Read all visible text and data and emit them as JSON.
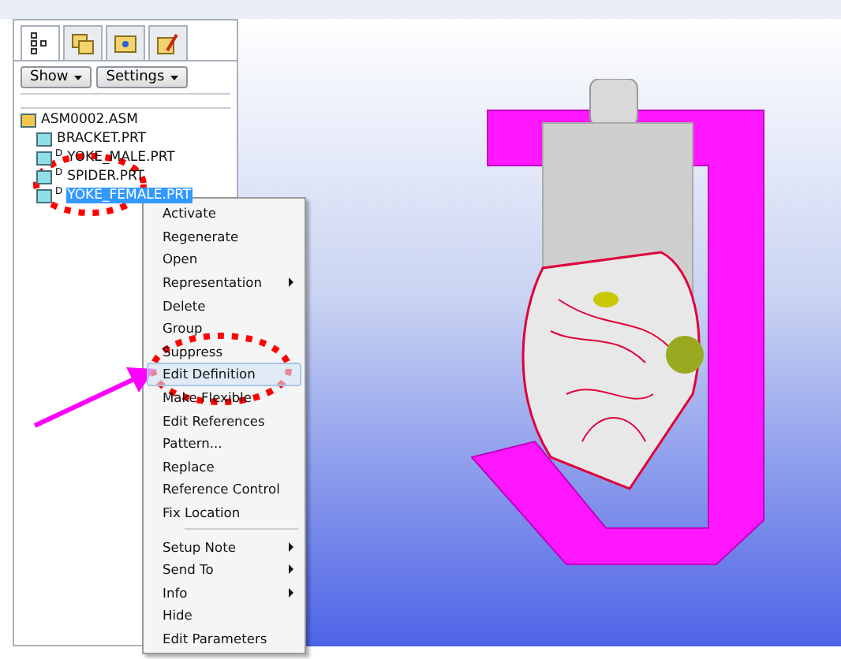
{
  "panel": {
    "tabs": [
      {
        "selected": true
      },
      {
        "selected": false
      },
      {
        "selected": false
      },
      {
        "selected": false
      }
    ],
    "buttons": [
      {
        "label": "Show"
      },
      {
        "label": "Settings"
      }
    ],
    "tree": {
      "label": "ASM0002.ASM",
      "children": [
        {
          "label": "BRACKET.PRT",
          "selected": false
        },
        {
          "label": "YOKE_MALE.PRT",
          "flag": "D",
          "selected": false
        },
        {
          "label": "SPIDER.PRT",
          "flag": "D",
          "selected": false
        },
        {
          "label": "YOKE_FEMALE.PRT",
          "flag": "D",
          "selected": true
        }
      ]
    }
  },
  "context_menu": {
    "groups": [
      [
        {
          "label": "Activate",
          "submenu": false,
          "selected": false
        },
        {
          "label": "Regenerate",
          "submenu": false,
          "selected": false
        },
        {
          "label": "Open",
          "submenu": false,
          "selected": false
        },
        {
          "label": "Representation",
          "submenu": true,
          "selected": false
        },
        {
          "label": "Delete",
          "submenu": false,
          "selected": false
        },
        {
          "label": "Group",
          "submenu": false,
          "selected": false
        },
        {
          "label": "Suppress",
          "submenu": false,
          "selected": false
        },
        {
          "label": "Edit Definition",
          "submenu": false,
          "selected": true
        },
        {
          "label": "Make Flexible",
          "submenu": false,
          "selected": false
        },
        {
          "label": "Edit References",
          "submenu": false,
          "selected": false
        },
        {
          "label": "Pattern...",
          "submenu": false,
          "selected": false
        },
        {
          "label": "Replace",
          "submenu": false,
          "selected": false
        },
        {
          "label": "Reference Control",
          "submenu": false,
          "selected": false
        },
        {
          "label": "Fix Location",
          "submenu": false,
          "selected": false
        }
      ],
      [
        {
          "label": "Setup Note",
          "submenu": true,
          "selected": false
        },
        {
          "label": "Send To",
          "submenu": true,
          "selected": false
        },
        {
          "label": "Info",
          "submenu": true,
          "selected": false
        },
        {
          "label": "Hide",
          "submenu": false,
          "selected": false
        },
        {
          "label": "Edit Parameters",
          "submenu": false,
          "selected": false
        }
      ]
    ]
  }
}
